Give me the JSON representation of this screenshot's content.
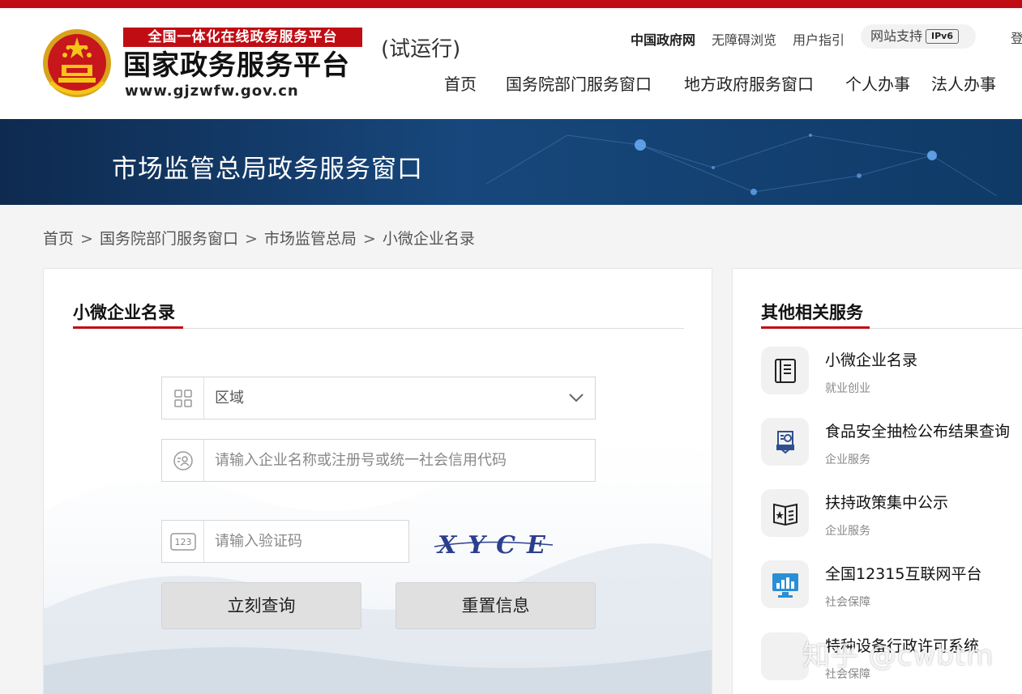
{
  "header": {
    "logo_banner": "全国一体化在线政务服务平台",
    "logo_title": "国家政务服务平台",
    "logo_url": "www.gjzwfw.gov.cn",
    "trial": "(试运行)",
    "utility": {
      "gov": "中国政府网",
      "accessibility": "无障碍浏览",
      "guide": "用户指引",
      "support": "网站支持",
      "ipv6": "IPv6",
      "login": "登"
    },
    "nav": [
      "首页",
      "国务院部门服务窗口",
      "地方政府服务窗口",
      "个人办事",
      "法人办事"
    ]
  },
  "banner": {
    "title": "市场监管总局政务服务窗口"
  },
  "breadcrumb": [
    "首页",
    "国务院部门服务窗口",
    "市场监管总局",
    "小微企业名录"
  ],
  "breadcrumb_sep": ">",
  "form": {
    "title": "小微企业名录",
    "region_label": "区域",
    "company_placeholder": "请输入企业名称或注册号或统一社会信用代码",
    "captcha_placeholder": "请输入验证码",
    "captcha_text": "XYCE",
    "query_button": "立刻查询",
    "reset_button": "重置信息"
  },
  "related": {
    "title": "其他相关服务",
    "items": [
      {
        "name": "小微企业名录",
        "category": "就业创业",
        "icon": "book-icon"
      },
      {
        "name": "食品安全抽检公布结果查询",
        "category": "企业服务",
        "icon": "food-inspection-icon"
      },
      {
        "name": "扶持政策集中公示",
        "category": "企业服务",
        "icon": "policy-book-icon"
      },
      {
        "name": "全国12315互联网平台",
        "category": "社会保障",
        "icon": "monitor-chart-icon"
      },
      {
        "name": "特种设备行政许可系统",
        "category": "社会保障",
        "icon": "blank-icon"
      }
    ]
  },
  "watermark": "知乎 @cwbtm",
  "colors": {
    "brand_red": "#c00d14",
    "banner_blue": "#17477c"
  }
}
